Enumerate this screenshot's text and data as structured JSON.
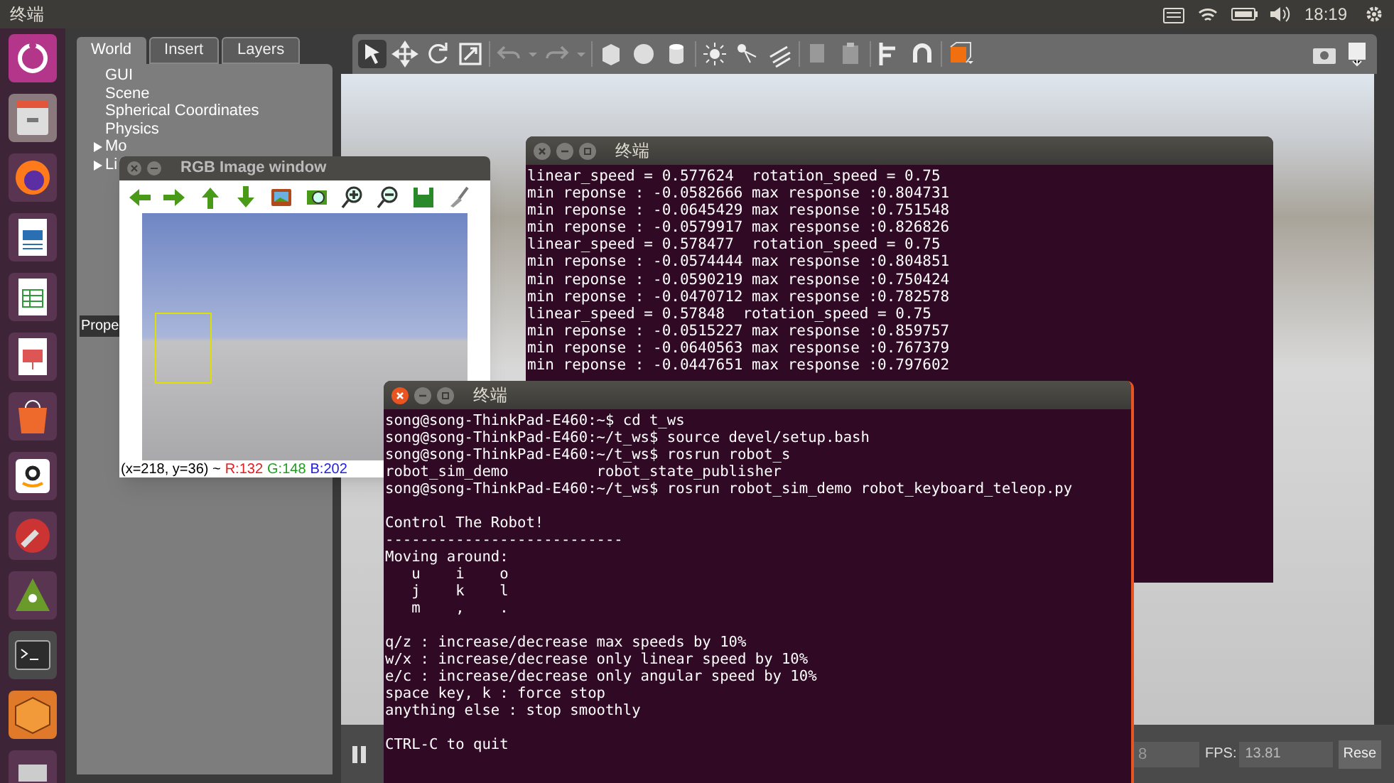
{
  "top_bar": {
    "title": "终端",
    "clock": "18:19"
  },
  "gazebo": {
    "tabs": [
      {
        "label": "World",
        "selected": true
      },
      {
        "label": "Insert",
        "selected": false
      },
      {
        "label": "Layers",
        "selected": false
      }
    ],
    "world_tree": [
      {
        "label": "GUI",
        "kind": "leaf"
      },
      {
        "label": "Scene",
        "kind": "leaf"
      },
      {
        "label": "Spherical Coordinates",
        "kind": "leaf"
      },
      {
        "label": "Physics",
        "kind": "leaf"
      },
      {
        "label": "Mo",
        "kind": "group",
        "expanded": false
      },
      {
        "label": "Li",
        "kind": "group",
        "expanded": false
      }
    ],
    "properties_label": "Prope",
    "bottom_bar": {
      "iterations_value": "8",
      "fps_label": "FPS:",
      "fps_value": "13.81",
      "reset_button": "Rese"
    }
  },
  "rgb_window": {
    "title": "RGB Image window",
    "status": {
      "coords": "(x=218, y=36) ~",
      "r": "R:132",
      "g": "G:148",
      "b": "B:202"
    }
  },
  "terminals": [
    {
      "title": "终端",
      "focused": false,
      "blocks": [
        [
          "linear_speed = 0.577624  rotation_speed = 0.75",
          "min reponse : -0.0582666 max response :0.804731",
          "min reponse : -0.0645429 max response :0.751548",
          "min reponse : -0.0579917 max response :0.826826",
          "linear_speed = 0.578477  rotation_speed = 0.75",
          "min reponse : -0.0574444 max response :0.804851",
          "min reponse : -0.0590219 max response :0.750424",
          "min reponse : -0.0470712 max response :0.782578",
          "linear_speed = 0.57848  rotation_speed = 0.75",
          "min reponse : -0.0515227 max response :0.859757",
          "min reponse : -0.0640563 max response :0.767379",
          "min reponse : -0.0447651 max response :0.797602"
        ]
      ]
    },
    {
      "title": "终端",
      "focused": true,
      "blocks": [
        [
          "song@song-ThinkPad-E460:~$ cd t_ws",
          "song@song-ThinkPad-E460:~/t_ws$ source devel/setup.bash",
          "song@song-ThinkPad-E460:~/t_ws$ rosrun robot_s",
          "robot_sim_demo          robot_state_publisher",
          "song@song-ThinkPad-E460:~/t_ws$ rosrun robot_sim_demo robot_keyboard_teleop.py"
        ],
        [
          "Control The Robot!",
          "---------------------------",
          "Moving around:",
          "   u    i    o",
          "   j    k    l",
          "   m    ,    ."
        ],
        [
          "q/z : increase/decrease max speeds by 10%",
          "w/x : increase/decrease only linear speed by 10%",
          "e/c : increase/decrease only angular speed by 10%",
          "space key, k : force stop",
          "anything else : stop smoothly"
        ],
        [
          "CTRL-C to quit"
        ]
      ]
    }
  ]
}
